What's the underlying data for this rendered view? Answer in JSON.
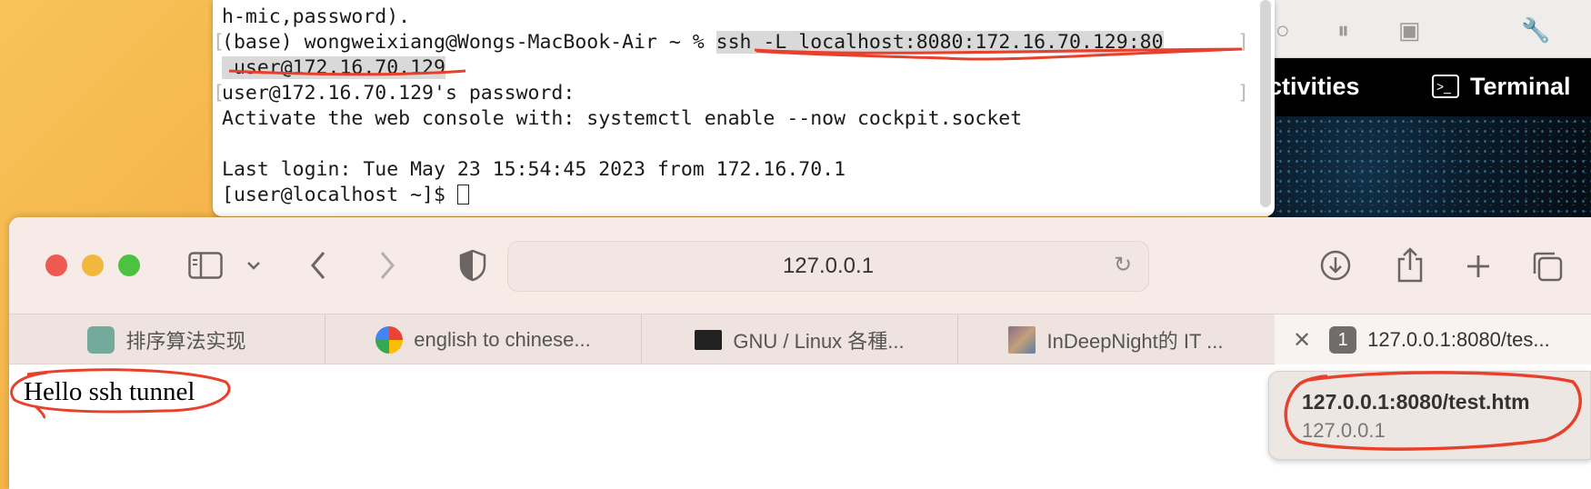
{
  "terminal": {
    "lines": [
      "h-mic,password).",
      "(base) wongweixiang@Wongs-MacBook-Air ~ % ",
      "ssh -L localhost:8080:172.16.70.129:80",
      " user@172.16.70.129",
      "user@172.16.70.129's password:",
      "Activate the web console with: systemctl enable --now cockpit.socket",
      "",
      "Last login: Tue May 23 15:54:45 2023 from 172.16.70.1",
      "[user@localhost ~]$ "
    ]
  },
  "vm_window": {
    "activities_label": "ctivities",
    "terminal_label": "Terminal",
    "terminal_icon": ">_"
  },
  "browser": {
    "address": "127.0.0.1",
    "tabs": [
      {
        "label": "排序算法实现",
        "icon": "chatgpt-icon"
      },
      {
        "label": "english to chinese...",
        "icon": "google-icon"
      },
      {
        "label": "GNU / Linux 各種...",
        "icon": "terminal-favicon"
      },
      {
        "label": "InDeepNight的 IT ...",
        "icon": "photo-favicon"
      },
      {
        "label": "127.0.0.1:8080/tes...",
        "badge": "1"
      }
    ],
    "page_text": "Hello ssh tunnel",
    "popup": {
      "title": "127.0.0.1:8080/test.htm",
      "subtitle": "127.0.0.1"
    }
  },
  "colors": {
    "annotation": "#e8402a",
    "toolbar_bg": "#f6ebe7"
  }
}
